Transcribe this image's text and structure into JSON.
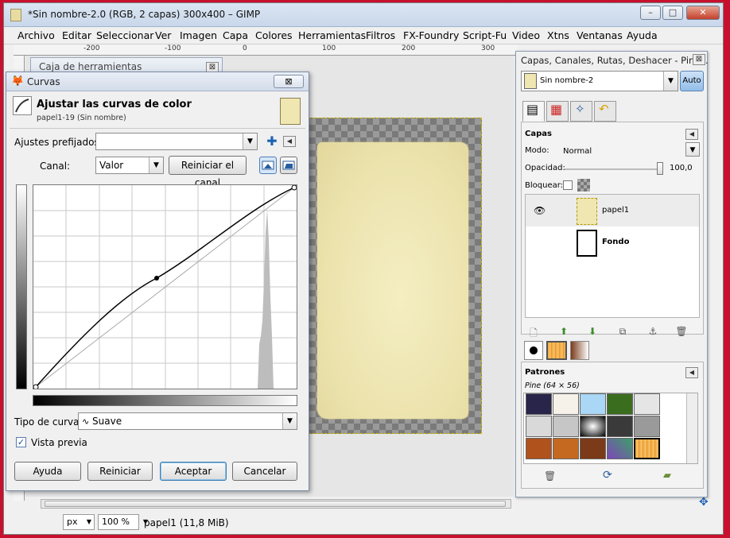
{
  "window": {
    "title": "*Sin nombre-2.0 (RGB, 2 capas) 300x400 – GIMP",
    "minimize": "–",
    "maximize": "□",
    "close": "✕"
  },
  "menu": [
    "Archivo",
    "Editar",
    "Seleccionar",
    "Ver",
    "Imagen",
    "Capa",
    "Colores",
    "Herramientas",
    "Filtros",
    "FX-Foundry",
    "Script-Fu",
    "Video",
    "Xtns",
    "Ventanas",
    "Ayuda"
  ],
  "ruler": {
    "labels": [
      "-200",
      "-100",
      "0",
      "100",
      "200",
      "300"
    ]
  },
  "toolbox": {
    "title": "Caja de herramientas",
    "close": "⊠"
  },
  "curves": {
    "title": "Curvas",
    "close": "⊠",
    "header_title": "Ajustar las curvas de color",
    "header_sub": "papel1-19 (Sin nombre)",
    "presets_label": "Ajustes prefijados:",
    "presets_value": "",
    "channel_label": "Canal:",
    "channel_value": "Valor",
    "reset_channel": "Reiniciar el canal",
    "curve_type_label": "Tipo de curva:",
    "curve_type_value": "Suave",
    "preview_label": "Vista previa",
    "preview_checked": true,
    "buttons": {
      "help": "Ayuda",
      "reset": "Reiniciar",
      "ok": "Aceptar",
      "cancel": "Cancelar"
    }
  },
  "statusbar": {
    "unit": "px",
    "zoom": "100 %",
    "text": "papel1 (11,8 MiB)"
  },
  "dock": {
    "title": "Capas, Canales, Rutas, Deshacer - Pinc...",
    "image_select": "Sin nombre-2",
    "auto": "Auto",
    "layers_header": "Capas",
    "mode_label": "Modo:",
    "mode_value": "Normal",
    "opacity_label": "Opacidad:",
    "opacity_value": "100,0",
    "lock_label": "Bloquear:",
    "layers": [
      {
        "name": "papel1",
        "visible": true
      },
      {
        "name": "Fondo",
        "visible": false
      }
    ],
    "patterns_header": "Patrones",
    "pattern_name": "Pine (64 × 56)"
  },
  "colors": {
    "desktop": "#c8102e",
    "paper": "#f0e8b8",
    "accent": "#1e62b5"
  }
}
